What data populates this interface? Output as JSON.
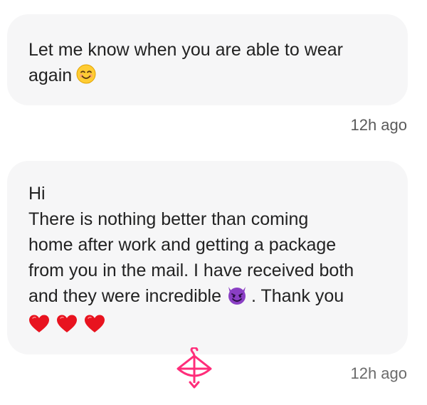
{
  "messages": [
    {
      "lines": [
        "Let me know when you are able to wear",
        "again"
      ],
      "emoji": "smiling-face-icon",
      "timestamp": "12h ago"
    },
    {
      "lines": [
        "Hi",
        "There is nothing better than coming",
        "home after work and getting a package",
        "from you in the mail. I have received both",
        "and they were incredible",
        ". Thank you"
      ],
      "emoji": "smiling-devil-icon",
      "trailing_emoji": [
        "heart-icon",
        "heart-icon",
        "heart-icon"
      ],
      "timestamp": "12h ago"
    }
  ],
  "colors": {
    "bubble_background": "#f6f6f7",
    "text": "#222222",
    "timestamp": "#5a5a5a",
    "heart": "#e8131f",
    "devil": "#8a3fc4",
    "brand_logo": "#ff2d7a"
  },
  "brand": {
    "logo_icon": "hanger-bow-arrow-icon"
  }
}
